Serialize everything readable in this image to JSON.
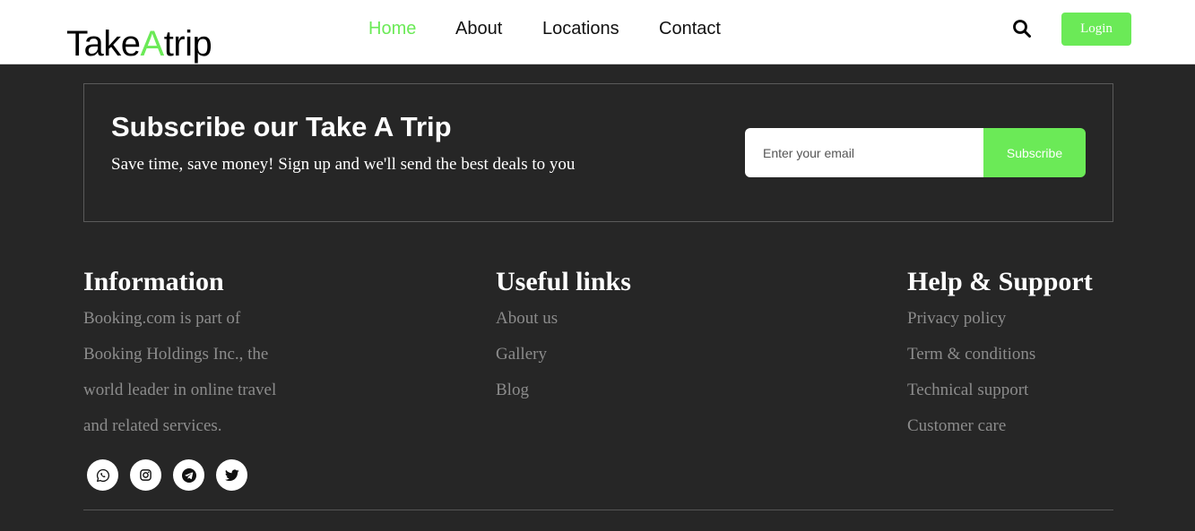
{
  "header": {
    "logo": {
      "part1": "Take",
      "accent": "A",
      "part2": "trip"
    },
    "nav": [
      {
        "label": "Home",
        "active": true
      },
      {
        "label": "About",
        "active": false
      },
      {
        "label": "Locations",
        "active": false
      },
      {
        "label": "Contact",
        "active": false
      }
    ],
    "search_icon": "search-icon",
    "login_label": "Login"
  },
  "subscribe": {
    "title": "Subscribe our Take A Trip",
    "text": "Save time, save money! Sign up and we'll send the best deals to you",
    "email_placeholder": "Enter your email",
    "button_label": "Subscribe"
  },
  "footer": {
    "information": {
      "heading": "Information",
      "lines": [
        "Booking.com is part of",
        "Booking Holdings Inc., the",
        "world leader in online travel",
        "and related services."
      ]
    },
    "useful_links": {
      "heading": "Useful links",
      "items": [
        "About us",
        "Gallery",
        "Blog"
      ]
    },
    "help_support": {
      "heading": "Help & Support",
      "items": [
        "Privacy policy",
        "Term & conditions",
        "Technical support",
        "Customer care"
      ]
    },
    "socials": [
      "whatsapp-icon",
      "instagram-icon",
      "telegram-icon",
      "twitter-icon"
    ]
  },
  "colors": {
    "accent": "#6bea57",
    "footer_bg": "#262626",
    "muted_text": "#8c8c8c"
  }
}
